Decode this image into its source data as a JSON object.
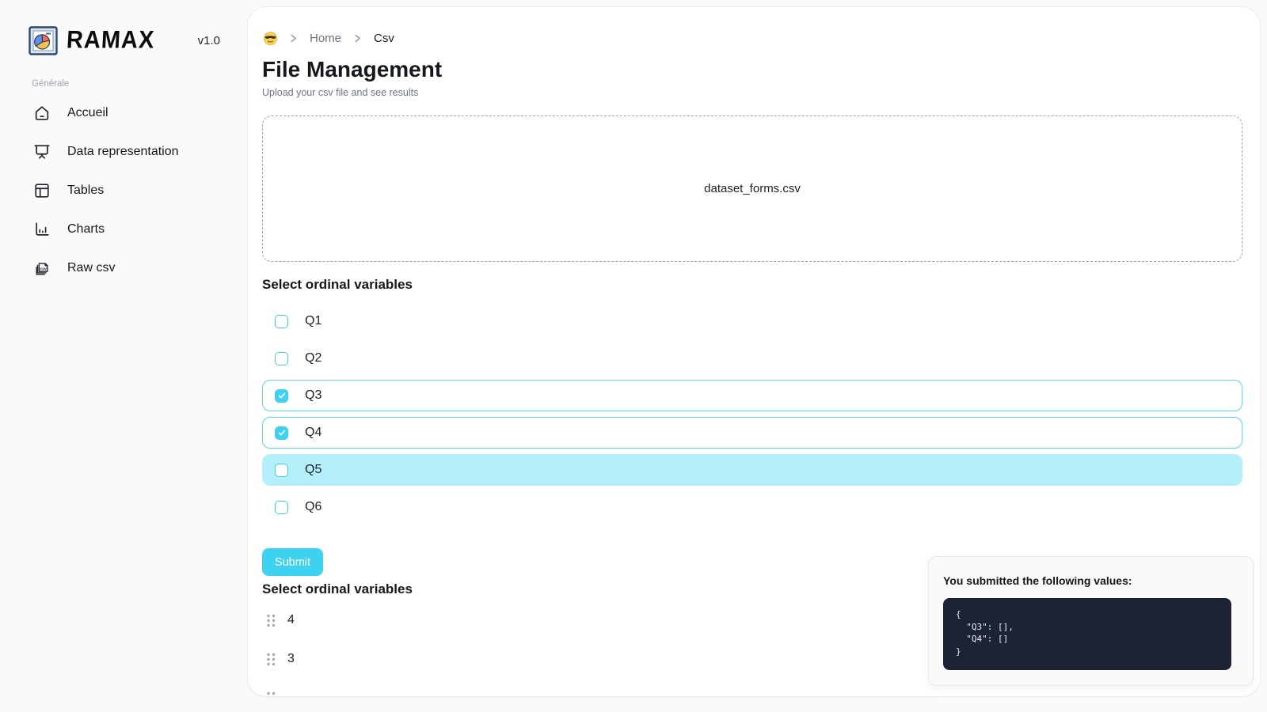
{
  "app": {
    "name": "RAMAX",
    "version": "v1.0"
  },
  "sidebar": {
    "section_label": "Générale",
    "items": [
      {
        "label": "Accueil",
        "icon": "home-icon"
      },
      {
        "label": "Data representation",
        "icon": "presentation-icon"
      },
      {
        "label": "Tables",
        "icon": "table-icon"
      },
      {
        "label": "Charts",
        "icon": "bar-chart-icon"
      },
      {
        "label": "Raw csv",
        "icon": "csv-file-icon"
      }
    ]
  },
  "breadcrumb": {
    "emoji": "😎",
    "home": "Home",
    "current": "Csv"
  },
  "header": {
    "title": "File Management",
    "subtitle": "Upload your csv file and see results"
  },
  "dropzone": {
    "filename": "dataset_forms.csv"
  },
  "checkbox_section": {
    "heading": "Select ordinal variables",
    "options": [
      {
        "label": "Q1",
        "checked": false,
        "highlighted": false
      },
      {
        "label": "Q2",
        "checked": false,
        "highlighted": false
      },
      {
        "label": "Q3",
        "checked": true,
        "highlighted": false
      },
      {
        "label": "Q4",
        "checked": true,
        "highlighted": false
      },
      {
        "label": "Q5",
        "checked": false,
        "highlighted": true
      },
      {
        "label": "Q6",
        "checked": false,
        "highlighted": false
      }
    ]
  },
  "submit": {
    "label": "Submit"
  },
  "sortable_section": {
    "heading": "Select ordinal variables",
    "items": [
      "4",
      "3"
    ],
    "third_item_partially_visible": true
  },
  "toast": {
    "title": "You submitted the following values:",
    "code": "{\n  \"Q3\": [],\n  \"Q4\": []\n}"
  },
  "colors": {
    "accent": "#3CD2F0",
    "accent_border": "#55D7F3",
    "row_highlight": "#B5EFFB",
    "code_background": "#1D2235",
    "page_background": "#FAFAFA"
  }
}
